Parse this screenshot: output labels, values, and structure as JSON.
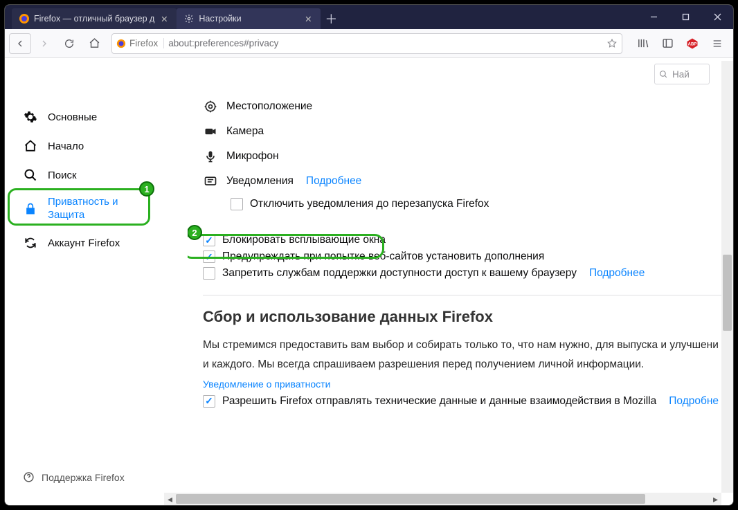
{
  "window": {
    "tabs": [
      {
        "title": "Firefox — отличный браузер д",
        "active": false,
        "icon": "firefox"
      },
      {
        "title": "Настройки",
        "active": true,
        "icon": "gear"
      }
    ],
    "controls": {
      "minimize": "—",
      "maximize": "◻",
      "close": "✕"
    }
  },
  "toolbar": {
    "url_prefix_label": "Firefox",
    "url": "about:preferences#privacy"
  },
  "page_search": {
    "placeholder": "Най"
  },
  "sidebar": {
    "items": [
      {
        "label": "Основные",
        "icon": "gear"
      },
      {
        "label": "Начало",
        "icon": "home"
      },
      {
        "label": "Поиск",
        "icon": "search"
      },
      {
        "label_line1": "Приватность и",
        "label_line2": "Защита",
        "icon": "lock",
        "selected": true
      },
      {
        "label": "Аккаунт Firefox",
        "icon": "sync"
      }
    ],
    "support": "Поддержка Firefox"
  },
  "permissions": {
    "location": "Местоположение",
    "camera": "Камера",
    "microphone": "Микрофон",
    "notifications": "Уведомления",
    "learn_more": "Подробнее",
    "disable_notifications_cb": "Отключить уведомления до перезапуска Firefox",
    "block_popups_cb": "Блокировать всплывающие окна",
    "warn_addons_cb": "Предупреждать при попытке веб-сайтов установить дополнения",
    "block_a11y_cb": "Запретить службам поддержки доступности доступ к вашему браузеру"
  },
  "data_section": {
    "title": "Сбор и использование данных Firefox",
    "paragraph": "Мы стремимся предоставить вам выбор и собирать только то, что нам нужно, для выпуска и улучшени и каждого. Мы всегда спрашиваем разрешения перед получением личной информации.",
    "privacy_notice": "Уведомление о приватности",
    "allow_telemetry_cb": "Разрешить Firefox отправлять технические данные и данные взаимодействия в Mozilla",
    "learn_more": "Подробне"
  },
  "annotations": {
    "badge1": "1",
    "badge2": "2"
  }
}
